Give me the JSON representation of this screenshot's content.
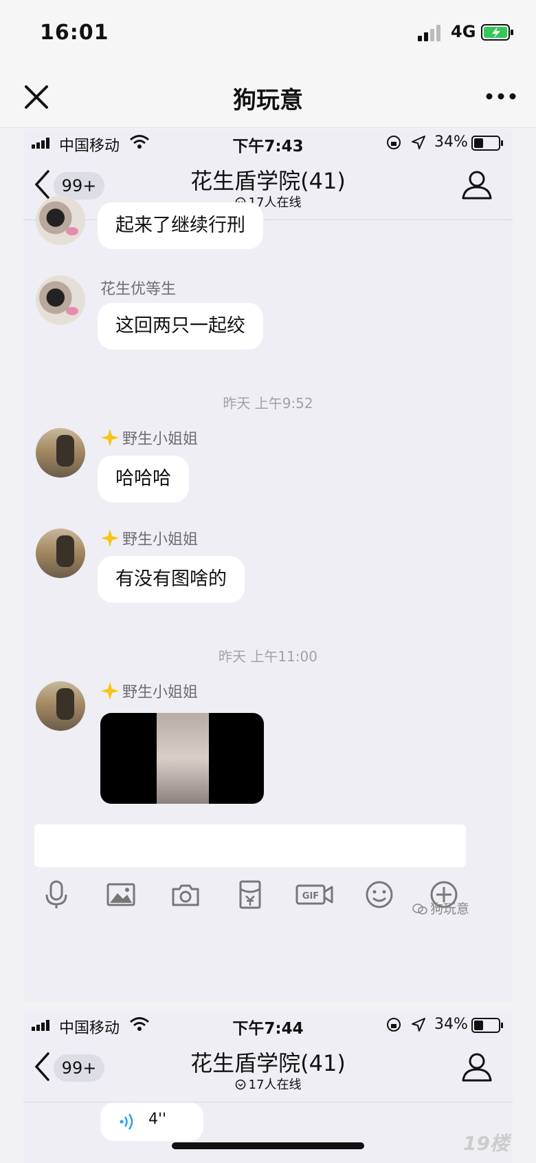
{
  "device": {
    "time": "16:01",
    "network": "4G"
  },
  "wechat": {
    "title": "狗玩意"
  },
  "screens": [
    {
      "status": {
        "carrier": "中国移动",
        "time": "下午7:43",
        "battery": "34%"
      },
      "header": {
        "back_badge": "99+",
        "group_name": "花生盾学院(41)",
        "online": "17人在线"
      },
      "messages": [
        {
          "text": "起来了继续行刑"
        },
        {
          "sender": "花生优等生",
          "text": "这回两只一起绞"
        },
        {
          "timestamp": "昨天 上午9:52"
        },
        {
          "sender": "野生小姐姐",
          "text": "哈哈哈"
        },
        {
          "sender": "野生小姐姐",
          "text": "有没有图啥的"
        },
        {
          "timestamp": "昨天 上午11:00"
        },
        {
          "sender": "野生小姐姐",
          "type": "video"
        }
      ],
      "watermark": "狗玩意"
    },
    {
      "status": {
        "carrier": "中国移动",
        "time": "下午7:44",
        "battery": "34%"
      },
      "header": {
        "back_badge": "99+",
        "group_name": "花生盾学院(41)",
        "online": "17人在线"
      },
      "messages": [
        {
          "type": "voice",
          "duration": "4''"
        }
      ]
    }
  ],
  "site_mark": "19楼"
}
